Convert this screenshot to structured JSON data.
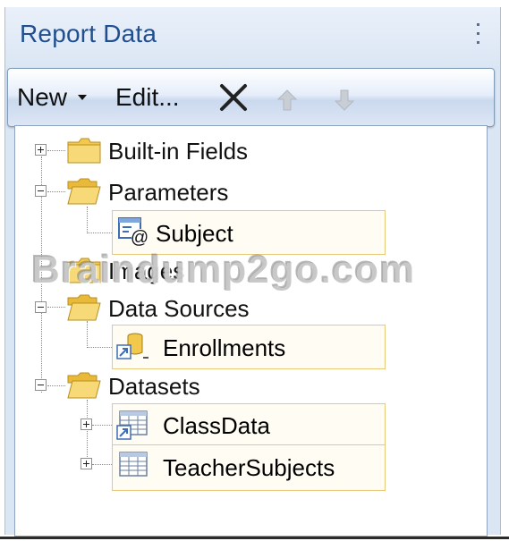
{
  "panel": {
    "title": "Report Data"
  },
  "toolbar": {
    "new_label": "New",
    "edit_label": "Edit..."
  },
  "tree": {
    "builtin_fields": "Built-in Fields",
    "parameters": "Parameters",
    "subject": "Subject",
    "images": "Images",
    "data_sources": "Data Sources",
    "enrollments": "Enrollments",
    "datasets": "Datasets",
    "classdata": "ClassData",
    "teachersubjects": "TeacherSubjects"
  },
  "watermark": "Braindump2go.com",
  "colors": {
    "title": "#1f4f8f",
    "selection_border": "#e8c97a",
    "folder": "#f2c94c"
  }
}
